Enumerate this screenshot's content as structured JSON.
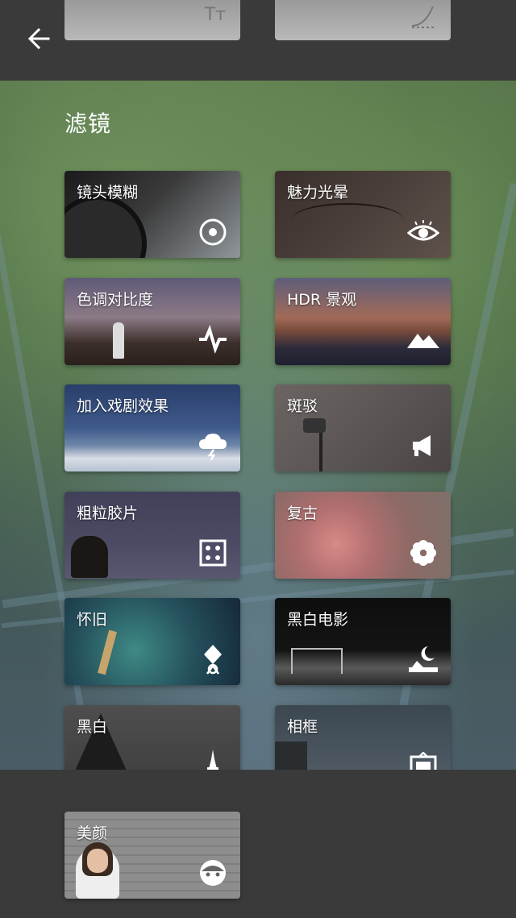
{
  "section_title": "滤镜",
  "filters": [
    {
      "label": "镜头模糊",
      "icon": "target-icon"
    },
    {
      "label": "魅力光晕",
      "icon": "eye-icon"
    },
    {
      "label": "色调对比度",
      "icon": "pulse-icon"
    },
    {
      "label": "HDR 景观",
      "icon": "mountains-icon"
    },
    {
      "label": "加入戏剧效果",
      "icon": "storm-cloud-icon"
    },
    {
      "label": "斑驳",
      "icon": "megaphone-icon"
    },
    {
      "label": "粗粒胶片",
      "icon": "dice-icon"
    },
    {
      "label": "复古",
      "icon": "flower-icon"
    },
    {
      "label": "怀旧",
      "icon": "ribbon-icon"
    },
    {
      "label": "黑白电影",
      "icon": "moon-icon"
    },
    {
      "label": "黑白",
      "icon": "eiffel-tower-icon"
    },
    {
      "label": "相框",
      "icon": "frame-icon"
    },
    {
      "label": "美颜",
      "icon": "face-icon"
    }
  ]
}
